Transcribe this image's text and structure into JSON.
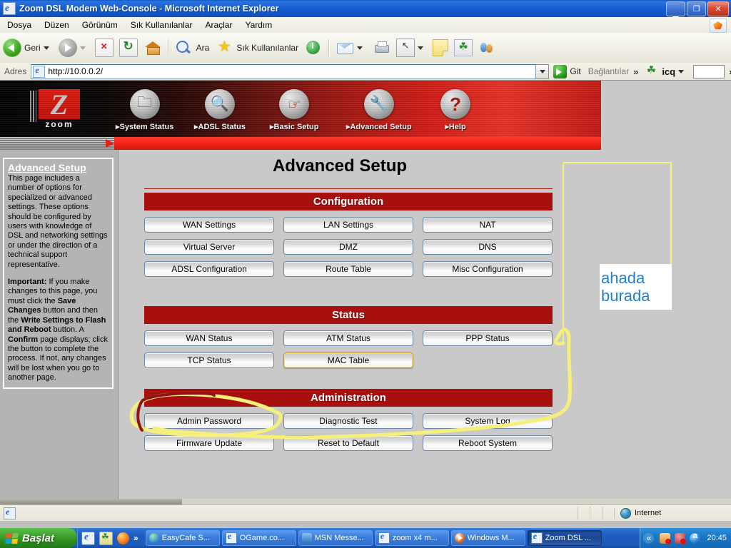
{
  "window": {
    "title": "Zoom DSL Modem Web-Console - Microsoft Internet Explorer",
    "icon": "ie-document-icon",
    "minimize_label": "_",
    "restore_label": "❐",
    "close_label": "✕"
  },
  "menu": {
    "items": [
      {
        "label": "Dosya"
      },
      {
        "label": "Düzen"
      },
      {
        "label": "Görünüm"
      },
      {
        "label": "Sık Kullanılanlar"
      },
      {
        "label": "Araçlar"
      },
      {
        "label": "Yardım"
      }
    ]
  },
  "toolbar": {
    "back_label": "Geri",
    "search_label": "Ara",
    "favorites_label": "Sık Kullanılanlar"
  },
  "address": {
    "label": "Adres",
    "value": "http://10.0.0.2/",
    "go_label": "Git",
    "links_label": "Bağlantılar",
    "icq_label": "icq",
    "icq_search_value": "",
    "chevron": "»"
  },
  "banner": {
    "logo_letter": "Z",
    "logo_name": "zoom",
    "nav": [
      {
        "label": "System Status",
        "icon": "folder-icon",
        "glyph": "🗀"
      },
      {
        "label": "ADSL Status",
        "icon": "magnifier-icon",
        "glyph": "🔍"
      },
      {
        "label": "Basic Setup",
        "icon": "hand-pointer-icon",
        "glyph": "☞"
      },
      {
        "label": "Advanced Setup",
        "icon": "wrench-icon",
        "glyph": "🔧"
      },
      {
        "label": "Help",
        "icon": "question-mark-icon",
        "glyph": "?"
      }
    ]
  },
  "sidebar": {
    "title": "Advanced Setup",
    "paragraph1": "This page includes a number of options for specialized or advanced settings. These options should be configured by users with knowledge of DSL and networking settings or under the direction of a technical support representative.",
    "important": {
      "lead": "Important:",
      "t1": " If you make changes to this page, you must click the ",
      "b1": "Save Changes",
      "t2": " button and then the ",
      "b2": "Write Settings to Flash and Reboot",
      "t3": " button. A ",
      "b3": "Confirm",
      "t4": " page displays; click the button to complete the process. If not, any changes will be lost when you go to another page."
    }
  },
  "page": {
    "title": "Advanced Setup",
    "sections": [
      {
        "heading": "Configuration",
        "rows": [
          [
            "WAN Settings",
            "LAN Settings",
            "NAT"
          ],
          [
            "Virtual Server",
            "DMZ",
            "DNS"
          ],
          [
            "ADSL Configuration",
            "Route Table",
            "Misc Configuration"
          ]
        ]
      },
      {
        "heading": "Status",
        "rows": [
          [
            "WAN Status",
            "ATM Status",
            "PPP Status"
          ],
          [
            "TCP Status",
            "MAC Table",
            ""
          ]
        ],
        "highlight": "MAC Table"
      },
      {
        "heading": "Administration",
        "rows": [
          [
            "Admin Password",
            "Diagnostic Test",
            "System Log"
          ],
          [
            "Firmware Update",
            "Reset to Default",
            "Reboot System"
          ]
        ]
      }
    ]
  },
  "annotation": {
    "callout_line1": "ahada",
    "callout_line2": "burada",
    "ink_color": "#f5f07a",
    "text_color": "#1f7fd0",
    "red_ink_color": "#8f1414"
  },
  "statusbar": {
    "zone": "Internet",
    "zone_icon": "globe-icon"
  },
  "taskbar": {
    "start_label": "Başlat",
    "quicklaunch": [
      {
        "icon": "ie-icon"
      },
      {
        "icon": "icq-icon"
      },
      {
        "icon": "firefox-icon"
      }
    ],
    "quicklaunch_chevron": "»",
    "tasks": [
      {
        "label": "EasyCafe S...",
        "icon": "globe-icon",
        "active": false
      },
      {
        "label": "OGame.co...",
        "icon": "ie-icon",
        "active": false
      },
      {
        "label": "MSN Messe...",
        "icon": "msn-icon",
        "active": false
      },
      {
        "label": "zoom x4 m...",
        "icon": "ie-icon",
        "active": false
      },
      {
        "label": "Windows M...",
        "icon": "wmp-icon",
        "active": false
      },
      {
        "label": "Zoom DSL ...",
        "icon": "ie-icon",
        "active": true
      }
    ],
    "tray_chevron": "«",
    "clock": "20:45"
  }
}
